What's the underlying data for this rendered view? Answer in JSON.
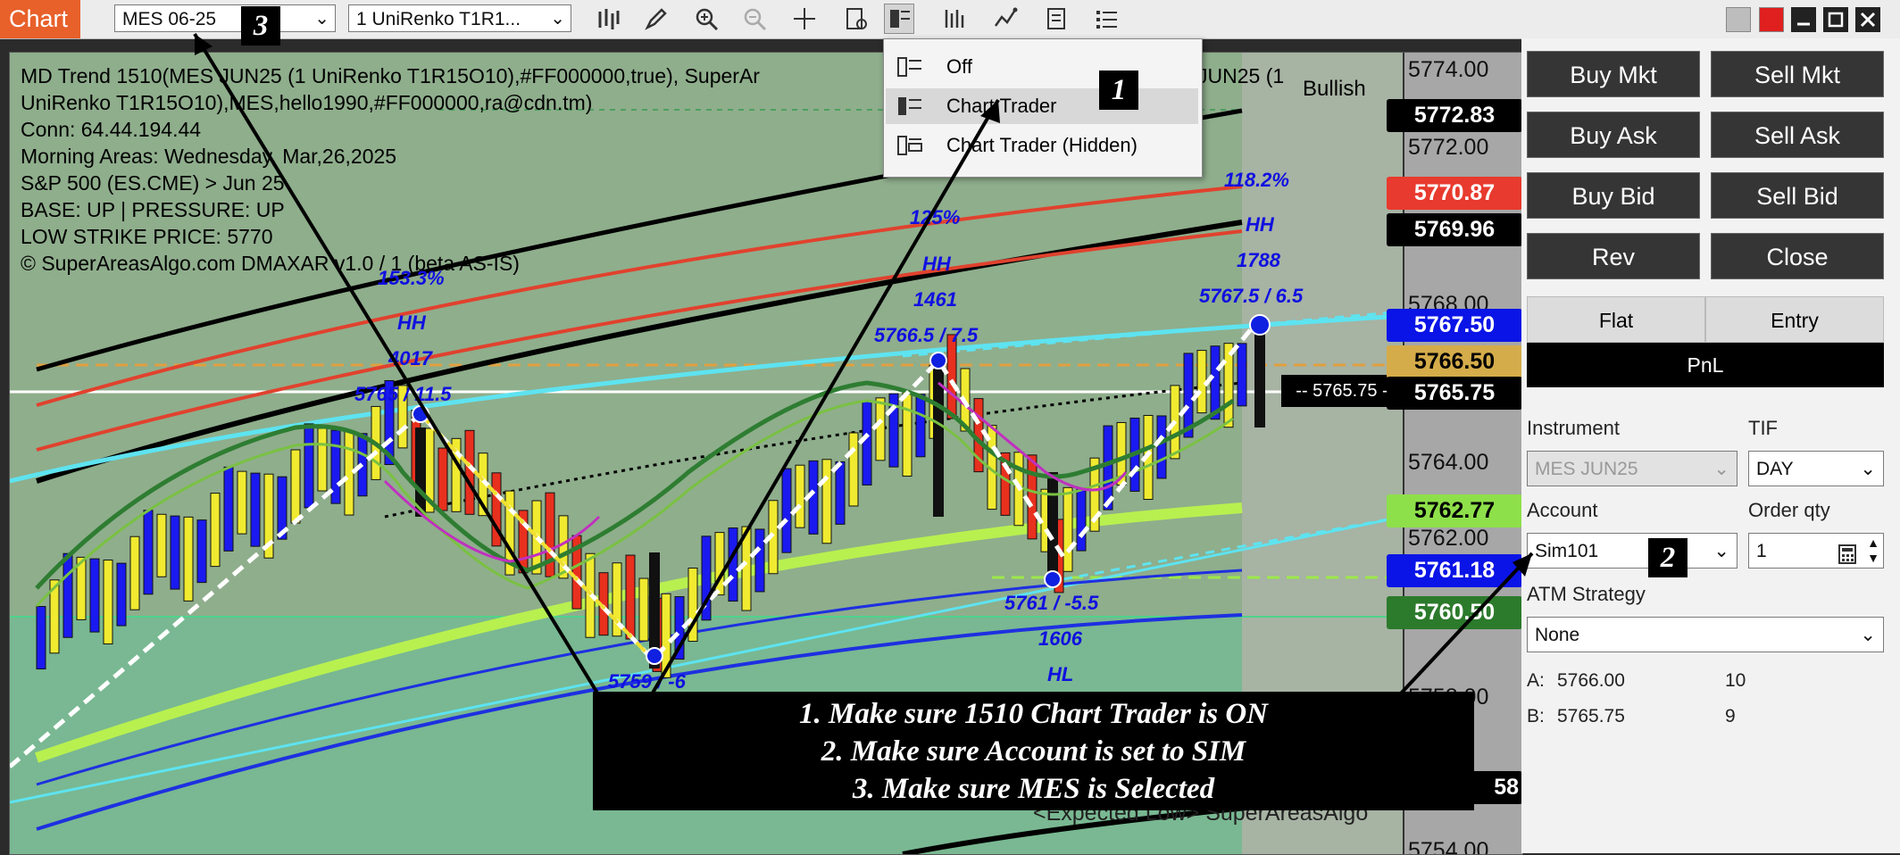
{
  "toolbar": {
    "title": "Chart",
    "instrument_combo": "MES 06-25",
    "series_combo": "1 UniRenko T1R1...",
    "icons": [
      "bars-icon",
      "pencil-icon",
      "zoom-in-icon",
      "zoom-out-icon",
      "crosshair-icon",
      "data-box-icon",
      "chart-trader-icon",
      "strategies-icon",
      "indicators-icon",
      "properties-icon",
      "list-icon"
    ]
  },
  "menu": {
    "items": [
      "Off",
      "Chart Trader",
      "Chart Trader (Hidden)"
    ],
    "selected": "Chart Trader"
  },
  "chart": {
    "info": [
      "MD Trend 1510(MES JUN25 (1 UniRenko T1R15O10),#FF000000,true), SuperAr",
      "UniRenko T1R15O10),MES,hello1990,#FF000000,ra@cdn.tm)",
      "Conn: 64.44.194.44",
      "Morning Areas: Wednesday, Mar,26,2025",
      "S&P 500 (ES.CME) > Jun 25",
      "BASE: UP | PRESSURE: UP",
      "LOW STRIKE PRICE: 5770",
      "© SuperAreasAlgo.com DMAXAR v1.0 / 1 (beta AS-IS)"
    ],
    "info_tail": "JUN25 (1",
    "bias": "Bullish",
    "bottom_text": "<Expected Low> SuperAreasAlgo",
    "crosshair_price": "-- 5765.75 -",
    "labels": [
      {
        "text": "153.3%"
      },
      {
        "text": "HH"
      },
      {
        "text": "4017"
      },
      {
        "text": "5765 / 11.5"
      },
      {
        "text": "5759 / -6"
      },
      {
        "text": "125%"
      },
      {
        "text": "HH"
      },
      {
        "text": "1461"
      },
      {
        "text": "5766.5 / 7.5"
      },
      {
        "text": "5761 / -5.5"
      },
      {
        "text": "1606"
      },
      {
        "text": "HL"
      },
      {
        "text": "118.2%"
      },
      {
        "text": "HH"
      },
      {
        "text": "1788"
      },
      {
        "text": "5767.5 / 6.5"
      }
    ],
    "axis_ticks": [
      "5774.00",
      "5772.00",
      "5768.00",
      "5764.00",
      "5762.00",
      "5758.00",
      "5754.00"
    ],
    "price_tags": [
      {
        "value": "5772.83",
        "bg": "#000000",
        "fg": "#ffffff"
      },
      {
        "value": "5770.87",
        "bg": "#e83a2e",
        "fg": "#ffffff"
      },
      {
        "value": "5769.96",
        "bg": "#000000",
        "fg": "#ffffff"
      },
      {
        "value": "5767.50",
        "bg": "#0a14e6",
        "fg": "#ffffff"
      },
      {
        "value": "5766.50",
        "bg": "#d4ac4a",
        "fg": "#000000"
      },
      {
        "value": "5765.75",
        "bg": "#000000",
        "fg": "#ffffff"
      },
      {
        "value": "5762.77",
        "bg": "#8ee04a",
        "fg": "#000000"
      },
      {
        "value": "5761.18",
        "bg": "#0a14e6",
        "fg": "#ffffff"
      },
      {
        "value": "5760.50",
        "bg": "#2c7a2c",
        "fg": "#ffffff"
      },
      {
        "value": "58",
        "bg": "#000000",
        "fg": "#ffffff"
      }
    ]
  },
  "panel": {
    "buttons": [
      "Buy Mkt",
      "Sell Mkt",
      "Buy Ask",
      "Sell Ask",
      "Buy Bid",
      "Sell Bid",
      "Rev",
      "Close"
    ],
    "flat": "Flat",
    "entry": "Entry",
    "pnl": "PnL",
    "instrument_label": "Instrument",
    "instrument_value": "MES JUN25",
    "tif_label": "TIF",
    "tif_value": "DAY",
    "account_label": "Account",
    "account_value": "Sim101",
    "qty_label": "Order qty",
    "qty_value": "1",
    "atm_label": "ATM Strategy",
    "atm_value": "None",
    "quote_a": {
      "label": "A:",
      "price": "5766.00",
      "size": "10"
    },
    "quote_b": {
      "label": "B:",
      "price": "5765.75",
      "size": "9"
    }
  },
  "annotations": {
    "badges": [
      "1",
      "2",
      "3"
    ],
    "instructions": [
      "1. Make sure 1510 Chart Trader is ON",
      "2. Make sure Account is set to SIM",
      "3. Make sure MES is Selected"
    ]
  }
}
